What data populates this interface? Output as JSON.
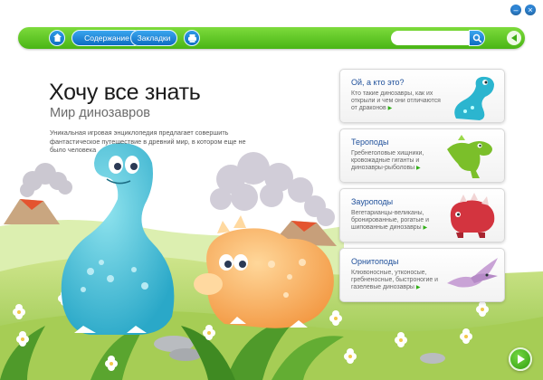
{
  "window": {
    "minimize_icon": "minimize-icon",
    "close_icon": "close-icon"
  },
  "toolbar": {
    "home_icon": "home-icon",
    "contents_label": "Содержание",
    "bookmarks_label": "Закладки",
    "print_icon": "print-icon",
    "search_value": "",
    "search_placeholder": "",
    "search_icon": "search-icon",
    "back_icon": "back-arrow-icon"
  },
  "header": {
    "title": "Хочу все знать",
    "subtitle": "Мир динозавров",
    "description": "Уникальная игровая энциклопедия предлагает совершить фантастическое путешествие в древний мир, в котором еще не было человека"
  },
  "cards": [
    {
      "title": "Ой, а кто это?",
      "description": "Кто такие динозавры, как их открыли и чем они отличаются от драконов",
      "arrow": "▶",
      "image_icon": "blue-dinosaur-icon",
      "color": "#2bb5cf"
    },
    {
      "title": "Тероподы",
      "description": "Гребнеголовые хищники, кровожадные гиганты и динозавры-рыболовы",
      "arrow": "▶",
      "image_icon": "green-theropod-icon",
      "color": "#7bbf2a"
    },
    {
      "title": "Зауроподы",
      "description": "Вегетарианцы-великаны, бронированные, рогатые и шипованные динозавры",
      "arrow": "▶",
      "image_icon": "red-ceratopsian-icon",
      "color": "#d3343f"
    },
    {
      "title": "Орнитоподы",
      "description": "Клювоносные, утконосые, гребненосные, быстроногие и газелевые динозавры",
      "arrow": "▶",
      "image_icon": "pterosaur-icon",
      "color": "#b58ac6"
    }
  ],
  "footer": {
    "next_icon": "play-arrow-icon"
  },
  "colors": {
    "toolbar_green": "#49b515",
    "button_blue": "#0d6cc1",
    "card_title_blue": "#1e4f9a",
    "grass": "#a9cf5e"
  }
}
